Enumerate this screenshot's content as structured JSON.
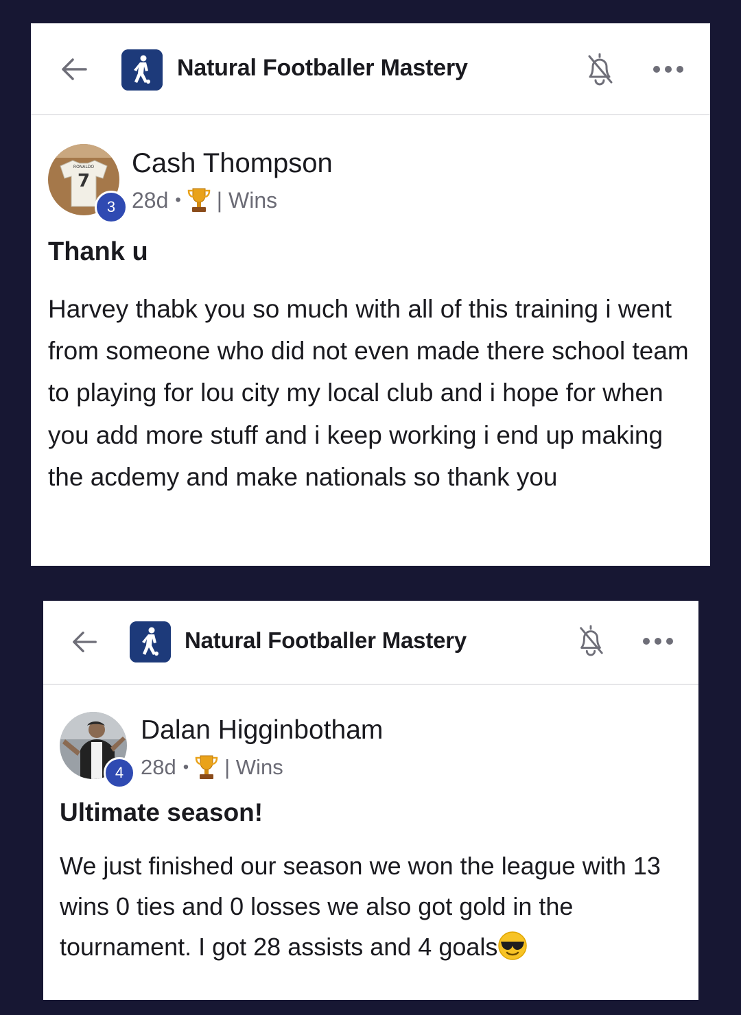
{
  "posts": [
    {
      "group": {
        "name": "Natural Footballer Mastery"
      },
      "author": {
        "name": "Cash Thompson",
        "level": "3",
        "avatar_text": "RONALDO",
        "avatar_number": "7"
      },
      "meta": {
        "time": "28d",
        "category": "| Wins"
      },
      "title": "Thank u",
      "body": "Harvey thabk you so much with all of this training i went from someone who did not even made there school team to playing for lou city my local club and i hope for when you add more stuff and i keep working i end up making the acdemy and make nationals so thank you"
    },
    {
      "group": {
        "name": "Natural Footballer Mastery"
      },
      "author": {
        "name": "Dalan Higginbotham",
        "level": "4"
      },
      "meta": {
        "time": "28d",
        "category": "| Wins"
      },
      "title": "Ultimate season!",
      "body": "We just finished our season we won the league with 13 wins 0 ties and 0 losses we also got gold in the tournament. I got 28 assists and 4 goals",
      "body_emoji": "sunglasses-emoji"
    }
  ],
  "colors": {
    "background": "#171733",
    "card": "#ffffff",
    "badge": "#2f4ab2",
    "logo": "#1d3a7a",
    "muted": "#6b6b75"
  },
  "icons": [
    "back-arrow-icon",
    "group-logo-icon",
    "bell-off-icon",
    "more-icon",
    "trophy-icon",
    "sunglasses-emoji"
  ]
}
